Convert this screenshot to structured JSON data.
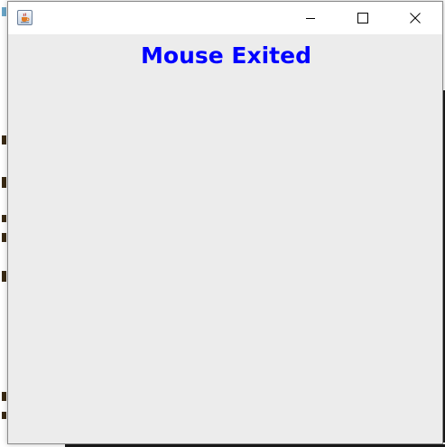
{
  "window": {
    "title": "",
    "icon": "java-cup-icon",
    "controls": {
      "minimize": "minimize-icon",
      "maximize": "maximize-icon",
      "close": "close-icon"
    }
  },
  "content": {
    "status_label": "Mouse Exited",
    "status_color": "#0000ff",
    "background": "#ececec"
  }
}
